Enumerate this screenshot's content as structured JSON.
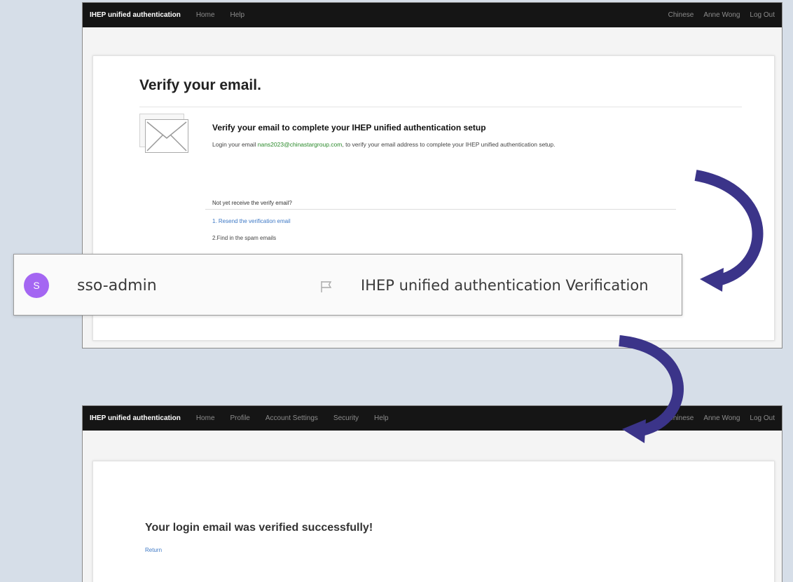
{
  "screen1": {
    "navbar": {
      "brand": "IHEP unified authentication",
      "links": [
        "Home",
        "Help"
      ],
      "right": [
        "Chinese",
        "Anne Wong",
        "Log Out"
      ]
    },
    "title": "Verify your email.",
    "heading": "Verify your email to complete your IHEP unified authentication setup",
    "desc_prefix": "Login your email ",
    "email": "nans2023@chinastargroup.com",
    "desc_suffix": ", to verify your email address to complete your IHEP unified authentication setup.",
    "not_received": "Not yet receive the verify email?",
    "step1": "1. Resend the verification email",
    "step2": "2.Find in the spam emails"
  },
  "email_row": {
    "avatar_letter": "S",
    "sender": "sso-admin",
    "flag_icon": "flag-icon",
    "subject": "IHEP unified authentication Verification"
  },
  "screen2": {
    "navbar": {
      "brand": "IHEP unified authentication",
      "links": [
        "Home",
        "Profile",
        "Account Settings",
        "Security",
        "Help"
      ],
      "right": [
        "Chinese",
        "Anne Wong",
        "Log Out"
      ]
    },
    "success": "Your login email was verified successfully!",
    "return": "Return"
  },
  "colors": {
    "background": "#d6dee8",
    "navbar": "#151515",
    "arrow": "#3b3489",
    "avatar": "#a466f2",
    "link": "#3d78c5",
    "email_link": "#2a8a2a"
  },
  "icons": [
    "envelope-icon",
    "flag-icon",
    "curved-arrow-icon"
  ]
}
